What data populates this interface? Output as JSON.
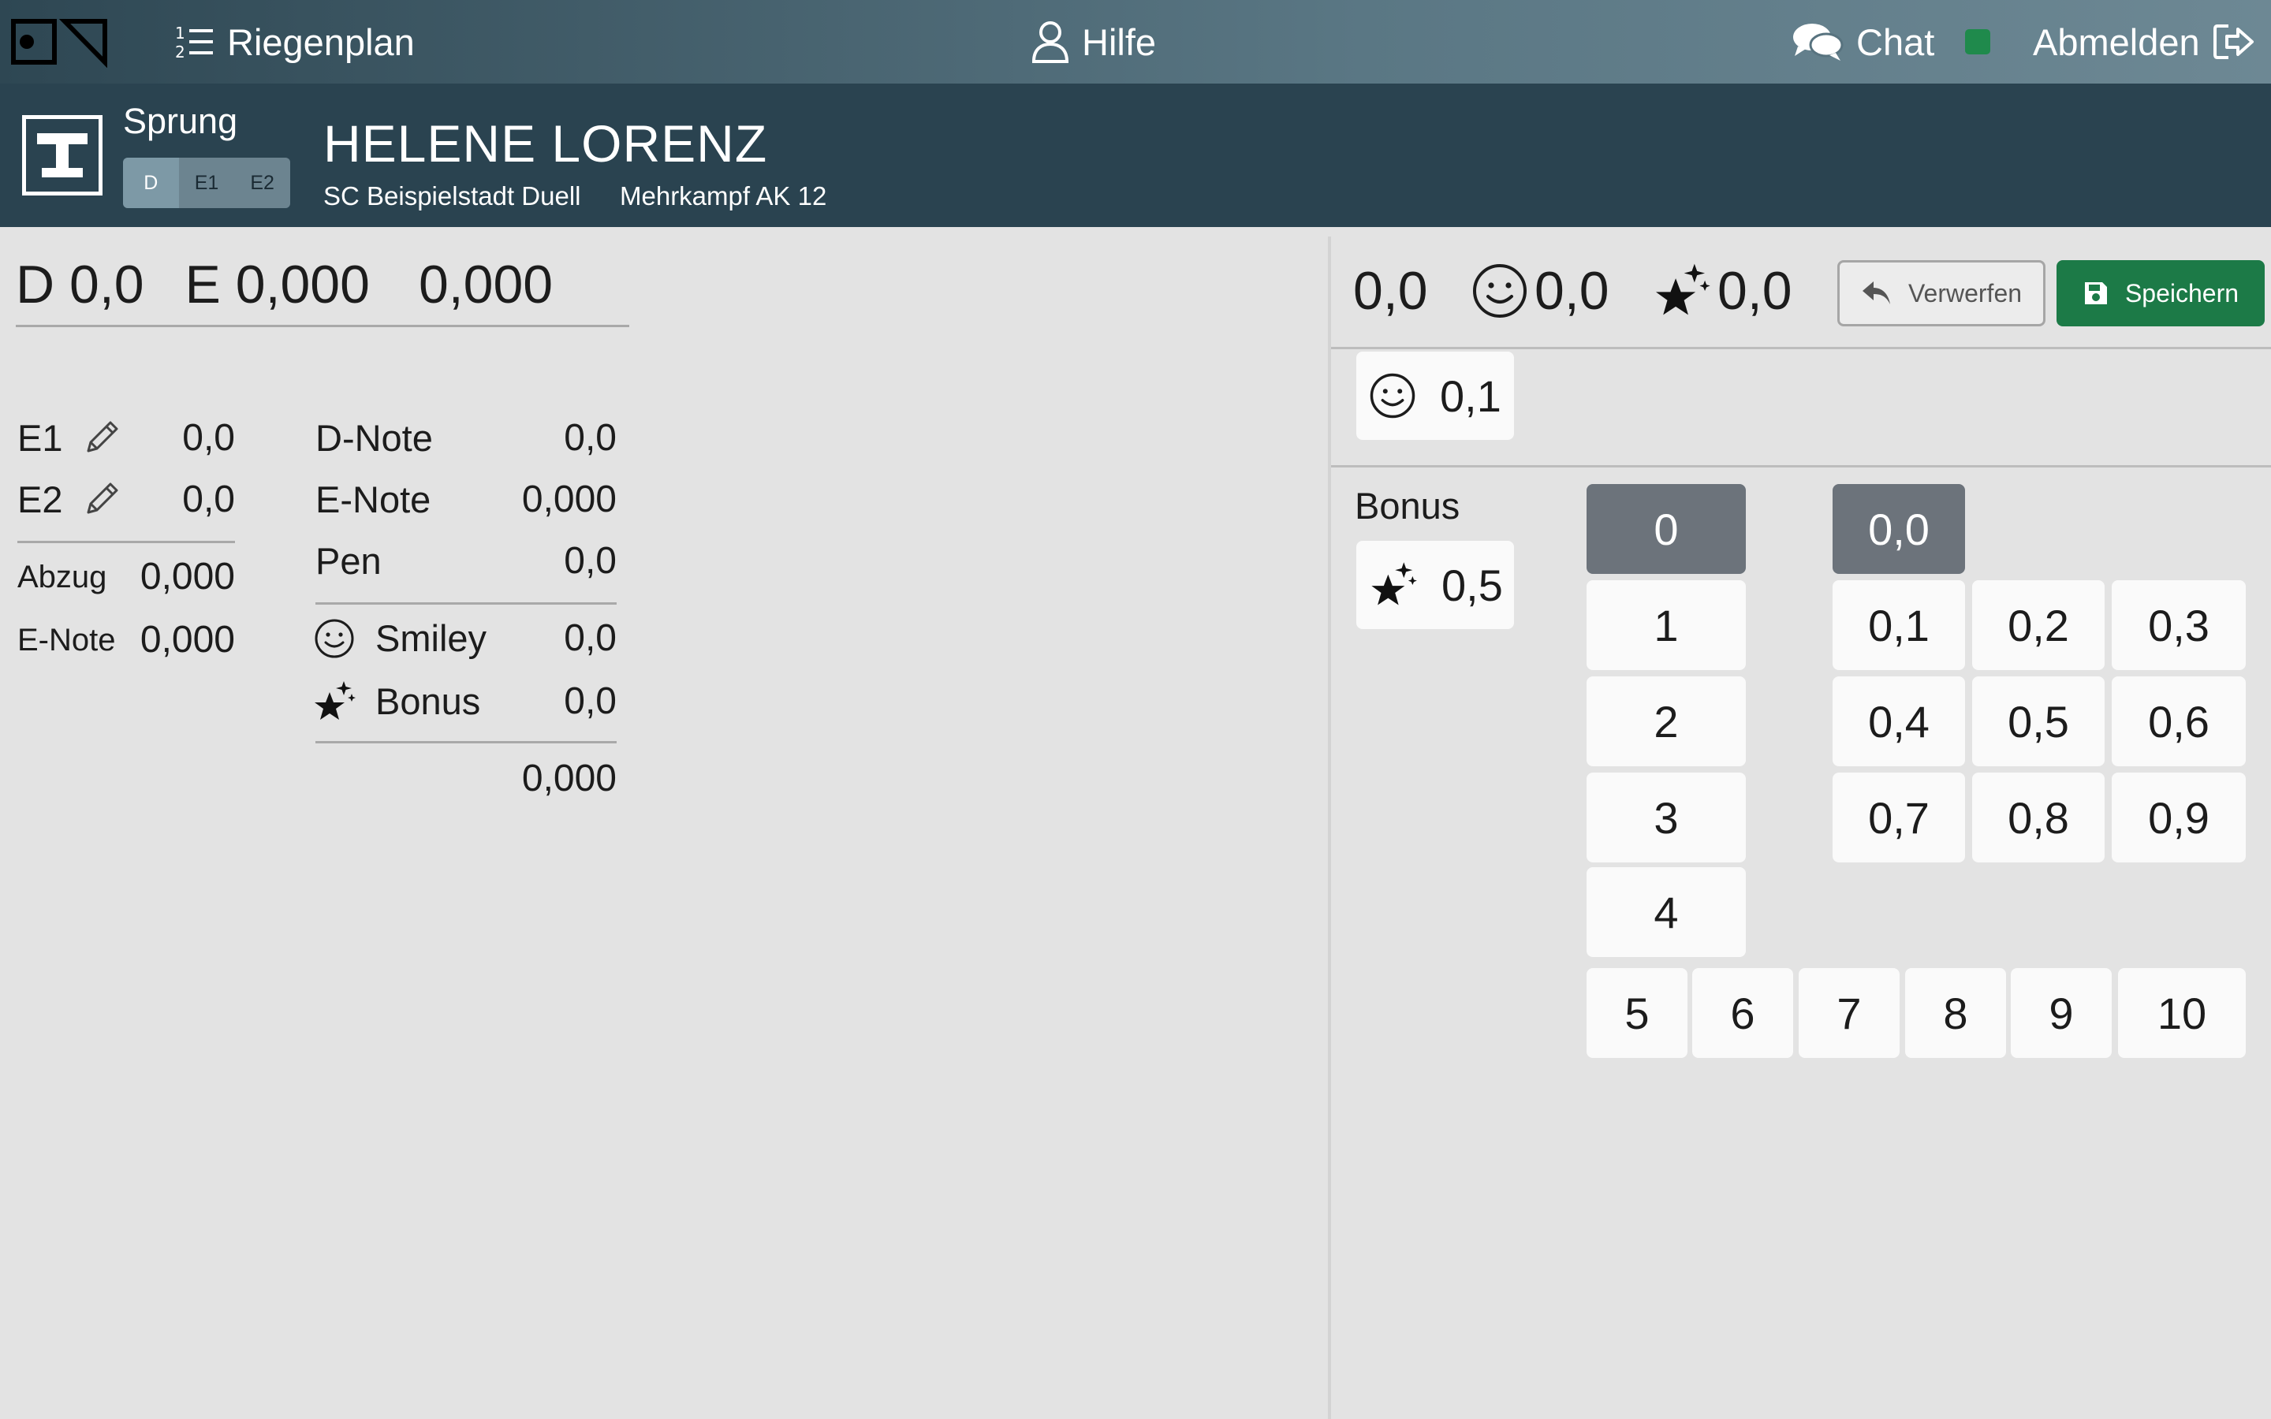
{
  "nav": {
    "riegenplan": "Riegenplan",
    "hilfe": "Hilfe",
    "chat": "Chat",
    "abmelden": "Abmelden",
    "status_color": "#1f8a4c"
  },
  "athlete": {
    "apparatus": "Sprung",
    "judge_tabs": [
      "D",
      "E1",
      "E2"
    ],
    "active_tab": "D",
    "name": "HELENE LORENZ",
    "club": "SC Beispielstadt Duell",
    "category": "Mehrkampf AK 12"
  },
  "summary": {
    "d": "D 0,0",
    "e": "E 0,000",
    "total": "0,000"
  },
  "left": {
    "e1_label": "E1",
    "e1_value": "0,0",
    "e2_label": "E2",
    "e2_value": "0,0",
    "abzug_label": "Abzug",
    "abzug_value": "0,000",
    "enote_label": "E-Note",
    "enote_value": "0,000"
  },
  "breakdown": {
    "dnote_label": "D-Note",
    "dnote_value": "0,0",
    "enote_label": "E-Note",
    "enote_value": "0,000",
    "pen_label": "Pen",
    "pen_value": "0,0",
    "smiley_label": "Smiley",
    "smiley_value": "0,0",
    "bonus_label": "Bonus",
    "bonus_value": "0,0",
    "total": "0,000"
  },
  "panel": {
    "score": "0,0",
    "smiley_score": "0,0",
    "bonus_score": "0,0",
    "discard_label": "Verwerfen",
    "save_label": "Speichern",
    "smiley_chip": "0,1",
    "bonus_label": "Bonus",
    "bonus_chip": "0,5",
    "accent": "#1c7a47",
    "selected_color": "#6c737b"
  },
  "keypad": {
    "integers": [
      "0",
      "1",
      "2",
      "3",
      "4"
    ],
    "integers_row": [
      "5",
      "6",
      "7",
      "8",
      "9",
      "10"
    ],
    "decimals": [
      "0,0",
      "0,1",
      "0,2",
      "0,3",
      "0,4",
      "0,5",
      "0,6",
      "0,7",
      "0,8",
      "0,9"
    ],
    "selected_integer": "0",
    "selected_decimal": "0,0"
  }
}
